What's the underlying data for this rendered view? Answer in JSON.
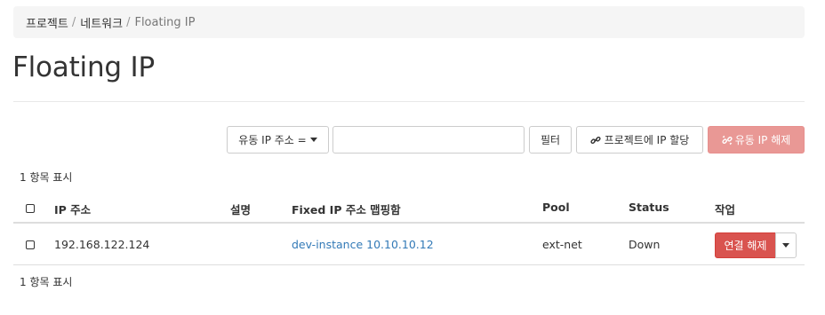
{
  "breadcrumb": {
    "items": [
      "프로젝트",
      "네트워크"
    ],
    "separator": "/",
    "current": "Floating IP"
  },
  "page": {
    "title": "Floating IP"
  },
  "toolbar": {
    "filter_field_label": "유동 IP 주소 =",
    "filter_input_value": "",
    "filter_button_label": "필터",
    "allocate_button_label": "프로젝트에 IP 할당",
    "release_button_label": "유동 IP 해제",
    "allocate_icon": "link-icon",
    "release_icon": "unlink-icon"
  },
  "table": {
    "count_top": "1 항목 표시",
    "count_bottom": "1 항목 표시",
    "headers": {
      "ip": "IP 주소",
      "description": "설명",
      "mapped": "Fixed IP 주소 맵핑함",
      "pool": "Pool",
      "status": "Status",
      "actions": "작업"
    },
    "rows": [
      {
        "ip": "192.168.122.124",
        "description": "",
        "mapped": "dev-instance 10.10.10.12",
        "pool": "ext-net",
        "status": "Down",
        "action_label": "연결 해제"
      }
    ]
  },
  "colors": {
    "danger": "#d9534f",
    "danger_disabled": "#e99895",
    "link": "#337ab7",
    "breadcrumb_bg": "#f5f5f5"
  }
}
